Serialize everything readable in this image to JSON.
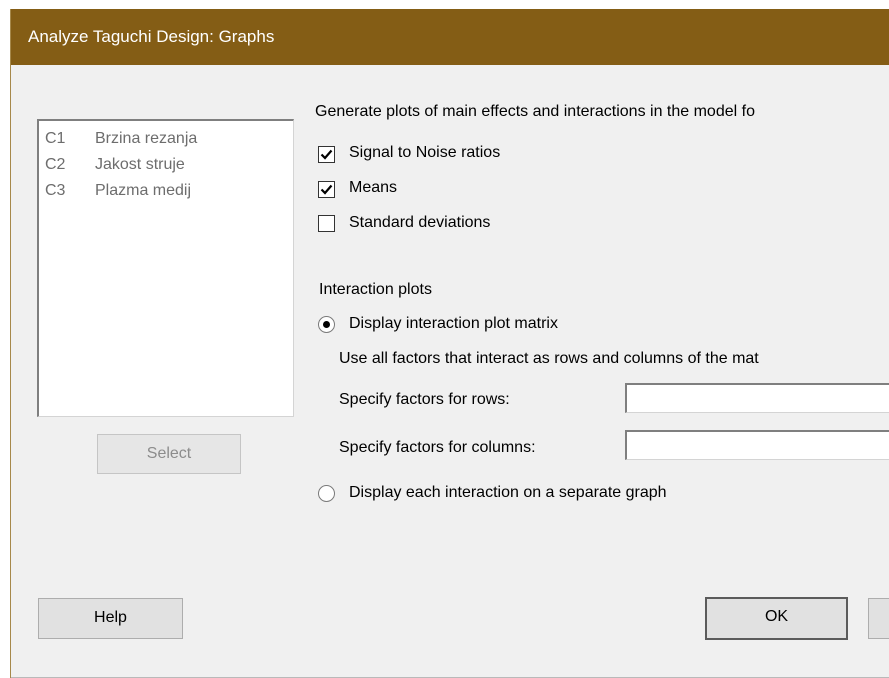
{
  "window": {
    "title": "Analyze Taguchi Design: Graphs"
  },
  "columns": [
    {
      "id": "C1",
      "name": "Brzina rezanja"
    },
    {
      "id": "C2",
      "name": "Jakost struje"
    },
    {
      "id": "C3",
      "name": "Plazma medij"
    }
  ],
  "select_button": "Select",
  "plots": {
    "heading": "Generate plots of main effects and interactions in the model fo",
    "options": [
      {
        "label": "Signal to Noise ratios",
        "checked": true
      },
      {
        "label": "Means",
        "checked": true
      },
      {
        "label": "Standard deviations",
        "checked": false
      }
    ]
  },
  "interaction": {
    "heading": "Interaction plots",
    "matrix_label": "Display interaction plot matrix",
    "matrix_selected": true,
    "use_all_text": "Use all factors that interact as rows and columns of the mat",
    "rows_label": "Specify factors for rows:",
    "rows_value": "",
    "columns_label": "Specify factors for columns:",
    "columns_value": "",
    "separate_label": "Display each interaction on a separate graph",
    "separate_selected": false
  },
  "buttons": {
    "help": "Help",
    "ok": "OK"
  }
}
